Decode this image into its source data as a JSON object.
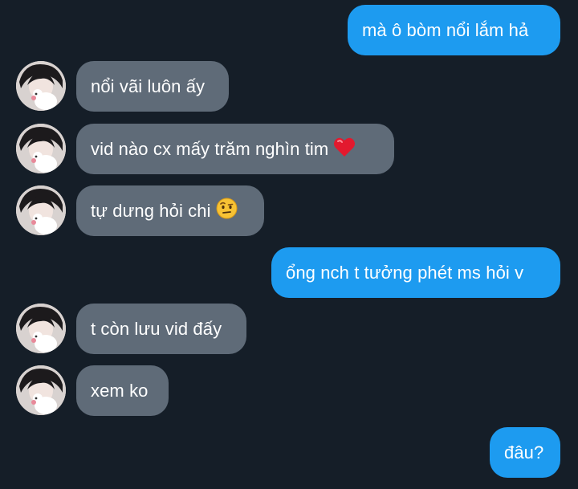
{
  "conversation": {
    "messages": [
      {
        "side": "outgoing",
        "text": "mà ô bòm nổi lắm hả"
      },
      {
        "side": "incoming",
        "text": "nổi vãi luôn ấy"
      },
      {
        "side": "incoming",
        "text": "vid nào cx mấy trăm nghìn tim",
        "emoji": "red-heart-icon"
      },
      {
        "side": "incoming",
        "text": "tự dưng hỏi chi",
        "emoji": "raised-eyebrow-emoji-icon"
      },
      {
        "side": "outgoing",
        "text": "ổng nch t tưởng phét ms hỏi v"
      },
      {
        "side": "incoming",
        "text": "t còn lưu vid đấy"
      },
      {
        "side": "incoming",
        "text": "xem ko"
      },
      {
        "side": "outgoing",
        "text": "đâu?"
      }
    ]
  },
  "colors": {
    "background": "#151e28",
    "outgoing_bubble": "#1d9bf0",
    "incoming_bubble": "#5f6b78",
    "text": "#ffffff"
  }
}
